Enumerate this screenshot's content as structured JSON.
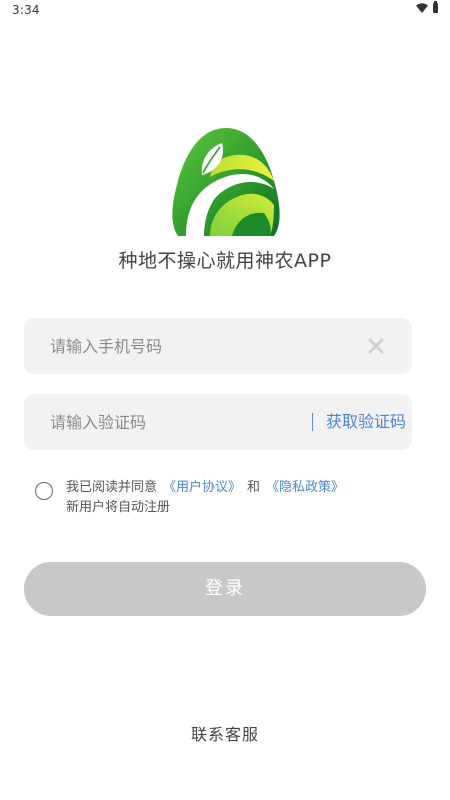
{
  "status_bar": {
    "time": "3:34"
  },
  "icons": {
    "wifi": "wifi-icon",
    "battery": "battery-icon",
    "clear": "close-icon",
    "logo": "leaf-logo"
  },
  "colors": {
    "accent_link": "#4a86d4",
    "login_button_disabled": "#c8c8c8",
    "input_background": "#f2f2f2",
    "logo_green": "#2e9d2c",
    "logo_yellow": "#e3ea35"
  },
  "header": {
    "slogan": "种地不操心就用神农APP"
  },
  "form": {
    "phone_placeholder": "请输入手机号码",
    "code_placeholder": "请输入验证码",
    "get_code_label": "获取验证码"
  },
  "agreement": {
    "prefix": "我已阅读并同意",
    "user_agreement": "《用户协议》",
    "and": "和",
    "privacy_policy": "《隐私政策》",
    "note": "新用户将自动注册"
  },
  "actions": {
    "login_label": "登录",
    "contact_label": "联系客服"
  }
}
